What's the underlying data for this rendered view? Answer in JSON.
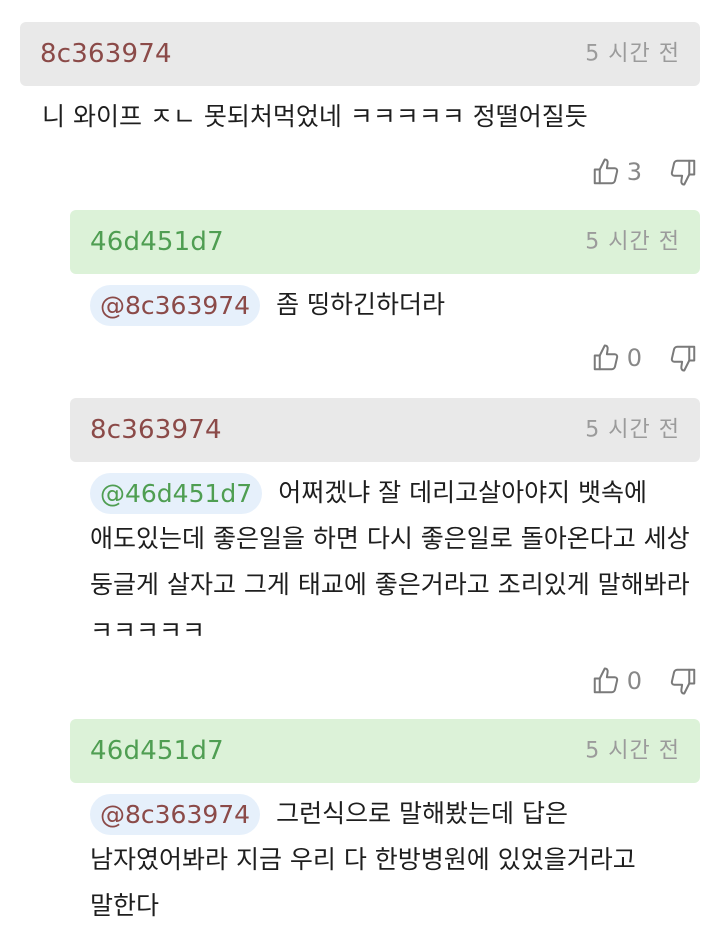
{
  "comments": [
    {
      "author": "8c363974",
      "time": "5 시간 전",
      "mention": "",
      "text": "니 와이프 ㅈㄴ 못되처먹었네 ㅋㅋㅋㅋㅋ 정떨어질듯",
      "likes": "3"
    },
    {
      "author": "46d451d7",
      "time": "5 시간 전",
      "mention": "@8c363974",
      "text": "좀 띵하긴하더라",
      "likes": "0"
    },
    {
      "author": "8c363974",
      "time": "5 시간 전",
      "mention": "@46d451d7",
      "text": "어쩌겠냐 잘 데리고살아야지 뱃속에 애도있는데 좋은일을 하면 다시 좋은일로 돌아온다고 세상 둥글게 살자고 그게 태교에 좋은거라고 조리있게 말해봐라 ㅋㅋㅋㅋㅋ",
      "likes": "0"
    },
    {
      "author": "46d451d7",
      "time": "5 시간 전",
      "mention": "@8c363974",
      "text": "그런식으로 말해봤는데 답은 남자였어봐라 지금 우리 다 한방병원에 있었을거라고 말한다",
      "likes": ""
    }
  ],
  "colors": {
    "gray_header": "#e9e9e9",
    "green_header": "#dcf2d8",
    "author_red": "#8b4a48",
    "author_green": "#4f9e52",
    "mention_bg": "#e6f0fb"
  },
  "icons": [
    "thumbs-up-icon",
    "thumbs-down-icon"
  ]
}
